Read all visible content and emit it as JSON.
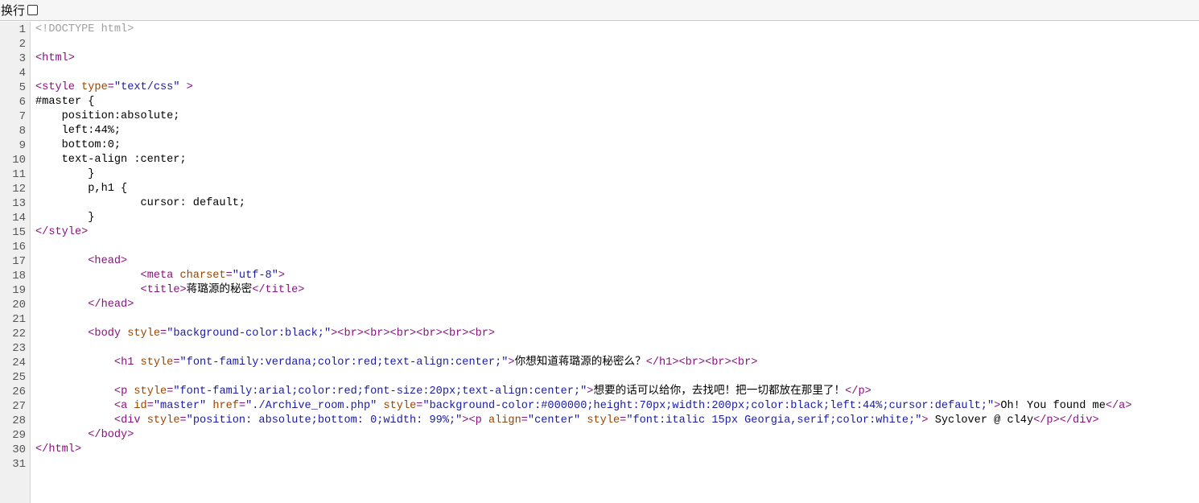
{
  "toolbar": {
    "wrap_label": "换行",
    "wrap_checked": false
  },
  "colors": {
    "plain": "#000000",
    "doctype": "#a0a0a0",
    "tag": "#881280",
    "attr": "#994500",
    "value": "#1a1aa6"
  },
  "lines": [
    {
      "n": "1",
      "tokens": [
        {
          "t": "doctype",
          "v": "<!DOCTYPE html>"
        }
      ]
    },
    {
      "n": "2",
      "tokens": []
    },
    {
      "n": "3",
      "tokens": [
        {
          "t": "tag",
          "v": "<html>"
        }
      ]
    },
    {
      "n": "4",
      "tokens": []
    },
    {
      "n": "5",
      "tokens": [
        {
          "t": "tag",
          "v": "<style "
        },
        {
          "t": "attr",
          "v": "type"
        },
        {
          "t": "tag",
          "v": "="
        },
        {
          "t": "value",
          "v": "\"text/css\""
        },
        {
          "t": "tag",
          "v": " >"
        }
      ]
    },
    {
      "n": "6",
      "tokens": [
        {
          "t": "plain",
          "v": "#master {"
        }
      ]
    },
    {
      "n": "7",
      "tokens": [
        {
          "t": "plain",
          "v": "    position:absolute;"
        }
      ]
    },
    {
      "n": "8",
      "tokens": [
        {
          "t": "plain",
          "v": "    left:44%;"
        }
      ]
    },
    {
      "n": "9",
      "tokens": [
        {
          "t": "plain",
          "v": "    bottom:0;"
        }
      ]
    },
    {
      "n": "10",
      "tokens": [
        {
          "t": "plain",
          "v": "    text-align :center;"
        }
      ]
    },
    {
      "n": "11",
      "tokens": [
        {
          "t": "plain",
          "v": "        }"
        }
      ]
    },
    {
      "n": "12",
      "tokens": [
        {
          "t": "plain",
          "v": "        p,h1 {"
        }
      ]
    },
    {
      "n": "13",
      "tokens": [
        {
          "t": "plain",
          "v": "                cursor: default;"
        }
      ]
    },
    {
      "n": "14",
      "tokens": [
        {
          "t": "plain",
          "v": "        }"
        }
      ]
    },
    {
      "n": "15",
      "tokens": [
        {
          "t": "tag",
          "v": "</style>"
        }
      ]
    },
    {
      "n": "16",
      "tokens": []
    },
    {
      "n": "17",
      "tokens": [
        {
          "t": "plain",
          "v": "        "
        },
        {
          "t": "tag",
          "v": "<head>"
        }
      ]
    },
    {
      "n": "18",
      "tokens": [
        {
          "t": "plain",
          "v": "                "
        },
        {
          "t": "tag",
          "v": "<meta "
        },
        {
          "t": "attr",
          "v": "charset"
        },
        {
          "t": "tag",
          "v": "="
        },
        {
          "t": "value",
          "v": "\"utf-8\""
        },
        {
          "t": "tag",
          "v": ">"
        }
      ]
    },
    {
      "n": "19",
      "tokens": [
        {
          "t": "plain",
          "v": "                "
        },
        {
          "t": "tag",
          "v": "<title>"
        },
        {
          "t": "plain",
          "v": "蒋璐源的秘密"
        },
        {
          "t": "tag",
          "v": "</title>"
        }
      ]
    },
    {
      "n": "20",
      "tokens": [
        {
          "t": "plain",
          "v": "        "
        },
        {
          "t": "tag",
          "v": "</head>"
        }
      ]
    },
    {
      "n": "21",
      "tokens": []
    },
    {
      "n": "22",
      "tokens": [
        {
          "t": "plain",
          "v": "        "
        },
        {
          "t": "tag",
          "v": "<body "
        },
        {
          "t": "attr",
          "v": "style"
        },
        {
          "t": "tag",
          "v": "="
        },
        {
          "t": "value",
          "v": "\"background-color:black;\""
        },
        {
          "t": "tag",
          "v": "><br><br><br><br><br><br>"
        }
      ]
    },
    {
      "n": "23",
      "tokens": []
    },
    {
      "n": "24",
      "tokens": [
        {
          "t": "plain",
          "v": "            "
        },
        {
          "t": "tag",
          "v": "<h1 "
        },
        {
          "t": "attr",
          "v": "style"
        },
        {
          "t": "tag",
          "v": "="
        },
        {
          "t": "value",
          "v": "\"font-family:verdana;color:red;text-align:center;\""
        },
        {
          "t": "tag",
          "v": ">"
        },
        {
          "t": "plain",
          "v": "你想知道蒋璐源的秘密么？"
        },
        {
          "t": "tag",
          "v": "</h1><br><br><br>"
        }
      ]
    },
    {
      "n": "25",
      "tokens": []
    },
    {
      "n": "26",
      "tokens": [
        {
          "t": "plain",
          "v": "            "
        },
        {
          "t": "tag",
          "v": "<p "
        },
        {
          "t": "attr",
          "v": "style"
        },
        {
          "t": "tag",
          "v": "="
        },
        {
          "t": "value",
          "v": "\"font-family:arial;color:red;font-size:20px;text-align:center;\""
        },
        {
          "t": "tag",
          "v": ">"
        },
        {
          "t": "plain",
          "v": "想要的话可以给你，去找吧！把一切都放在那里了！"
        },
        {
          "t": "tag",
          "v": "</p>"
        }
      ]
    },
    {
      "n": "27",
      "tokens": [
        {
          "t": "plain",
          "v": "            "
        },
        {
          "t": "tag",
          "v": "<a "
        },
        {
          "t": "attr",
          "v": "id"
        },
        {
          "t": "tag",
          "v": "="
        },
        {
          "t": "value",
          "v": "\"master\""
        },
        {
          "t": "tag",
          "v": " "
        },
        {
          "t": "attr",
          "v": "href"
        },
        {
          "t": "tag",
          "v": "="
        },
        {
          "t": "value",
          "v": "\"./Archive_room.php\""
        },
        {
          "t": "tag",
          "v": " "
        },
        {
          "t": "attr",
          "v": "style"
        },
        {
          "t": "tag",
          "v": "="
        },
        {
          "t": "value",
          "v": "\"background-color:#000000;height:70px;width:200px;color:black;left:44%;cursor:default;\""
        },
        {
          "t": "tag",
          "v": ">"
        },
        {
          "t": "plain",
          "v": "Oh! You found me"
        },
        {
          "t": "tag",
          "v": "</a>"
        }
      ]
    },
    {
      "n": "28",
      "tokens": [
        {
          "t": "plain",
          "v": "            "
        },
        {
          "t": "tag",
          "v": "<div "
        },
        {
          "t": "attr",
          "v": "style"
        },
        {
          "t": "tag",
          "v": "="
        },
        {
          "t": "value",
          "v": "\"position: absolute;bottom: 0;width: 99%;\""
        },
        {
          "t": "tag",
          "v": "><p "
        },
        {
          "t": "attr",
          "v": "align"
        },
        {
          "t": "tag",
          "v": "="
        },
        {
          "t": "value",
          "v": "\"center\""
        },
        {
          "t": "tag",
          "v": " "
        },
        {
          "t": "attr",
          "v": "style"
        },
        {
          "t": "tag",
          "v": "="
        },
        {
          "t": "value",
          "v": "\"font:italic 15px Georgia,serif;color:white;\""
        },
        {
          "t": "tag",
          "v": ">"
        },
        {
          "t": "plain",
          "v": " Syclover @ cl4y"
        },
        {
          "t": "tag",
          "v": "</p></div>"
        }
      ]
    },
    {
      "n": "29",
      "tokens": [
        {
          "t": "plain",
          "v": "        "
        },
        {
          "t": "tag",
          "v": "</body>"
        }
      ]
    },
    {
      "n": "30",
      "tokens": [
        {
          "t": "tag",
          "v": "</html>"
        }
      ]
    },
    {
      "n": "31",
      "tokens": []
    }
  ]
}
